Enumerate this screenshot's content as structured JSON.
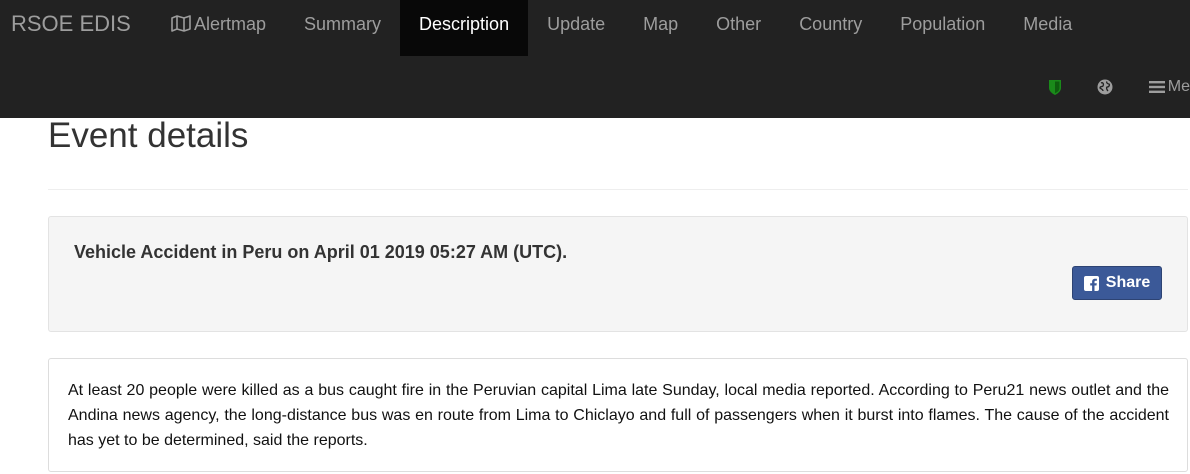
{
  "navbar": {
    "brand": "RSOE EDIS",
    "items": [
      {
        "label": "Alertmap",
        "icon": "map-icon"
      },
      {
        "label": "Summary"
      },
      {
        "label": "Description",
        "active": true
      },
      {
        "label": "Update"
      },
      {
        "label": "Map"
      },
      {
        "label": "Other"
      },
      {
        "label": "Country"
      },
      {
        "label": "Population"
      },
      {
        "label": "Media"
      }
    ],
    "secondary": {
      "shield_icon": "shield-icon",
      "globe_icon": "globe-icon",
      "menu_label": "Me"
    }
  },
  "page": {
    "title": "Event details"
  },
  "event": {
    "title": "Vehicle Accident in Peru on April 01 2019 05:27 AM (UTC).",
    "share_label": "Share",
    "description": "At least 20 people were killed as a bus caught fire in the Peruvian capital Lima late Sunday, local media reported. According to Peru21 news outlet and the Andina news agency, the long-distance bus was en route from Lima to Chiclayo and full of passengers when it burst into flames. The cause of the accident has yet to be determined, said the reports."
  },
  "colors": {
    "navbar_bg": "#222222",
    "active_bg": "#080808",
    "shield_green": "#1a8a1a",
    "facebook_blue": "#3b5998"
  }
}
